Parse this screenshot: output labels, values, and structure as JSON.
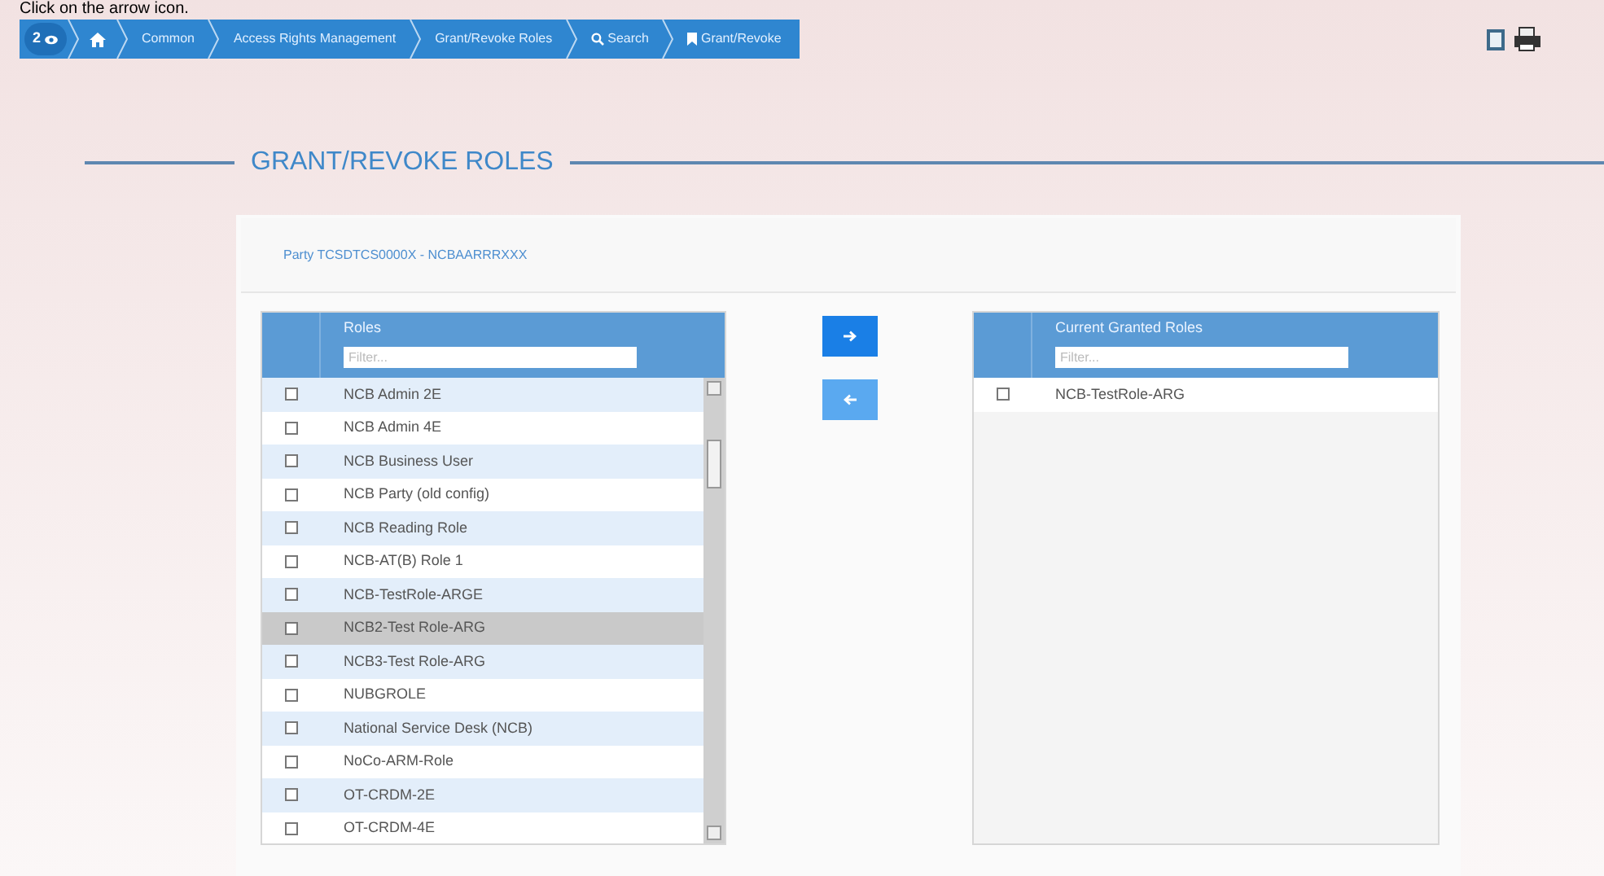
{
  "caption": "Click on the arrow icon.",
  "breadcrumb": [
    {
      "kind": "badge",
      "label": "2"
    },
    {
      "kind": "home"
    },
    {
      "kind": "text",
      "label": "Common"
    },
    {
      "kind": "text",
      "label": "Access Rights Management"
    },
    {
      "kind": "text",
      "label": "Grant/Revoke Roles"
    },
    {
      "kind": "search",
      "label": "Search"
    },
    {
      "kind": "bookmark",
      "label": "Grant/Revoke"
    }
  ],
  "title": "GRANT/REVOKE ROLES",
  "party": "Party TCSDTCS0000X - NCBAARRRXXX",
  "roles": {
    "header": "Roles",
    "filter_placeholder": "Filter...",
    "rows": [
      {
        "label": "NCB Admin 2E",
        "checked": false,
        "selected": false
      },
      {
        "label": "NCB Admin 4E",
        "checked": false,
        "selected": false
      },
      {
        "label": "NCB Business User",
        "checked": false,
        "selected": false
      },
      {
        "label": "NCB Party (old config)",
        "checked": false,
        "selected": false
      },
      {
        "label": "NCB Reading Role",
        "checked": false,
        "selected": false
      },
      {
        "label": "NCB-AT(B) Role 1",
        "checked": false,
        "selected": false
      },
      {
        "label": "NCB-TestRole-ARGE",
        "checked": false,
        "selected": false
      },
      {
        "label": "NCB2-Test Role-ARG",
        "checked": false,
        "selected": true
      },
      {
        "label": "NCB3-Test Role-ARG",
        "checked": false,
        "selected": false
      },
      {
        "label": "NUBGROLE",
        "checked": false,
        "selected": false
      },
      {
        "label": "National Service Desk (NCB)",
        "checked": false,
        "selected": false
      },
      {
        "label": "NoCo-ARM-Role",
        "checked": false,
        "selected": false
      },
      {
        "label": "OT-CRDM-2E",
        "checked": false,
        "selected": false
      },
      {
        "label": "OT-CRDM-4E",
        "checked": false,
        "selected": false
      }
    ]
  },
  "move_buttons": [
    {
      "kind": "right",
      "disabled": false
    },
    {
      "kind": "left",
      "disabled": true
    }
  ],
  "granted": {
    "header": "Current Granted Roles",
    "filter_placeholder": "Filter...",
    "rows": [
      {
        "label": "NCB-TestRole-ARG",
        "checked": false,
        "selected": false
      }
    ]
  }
}
